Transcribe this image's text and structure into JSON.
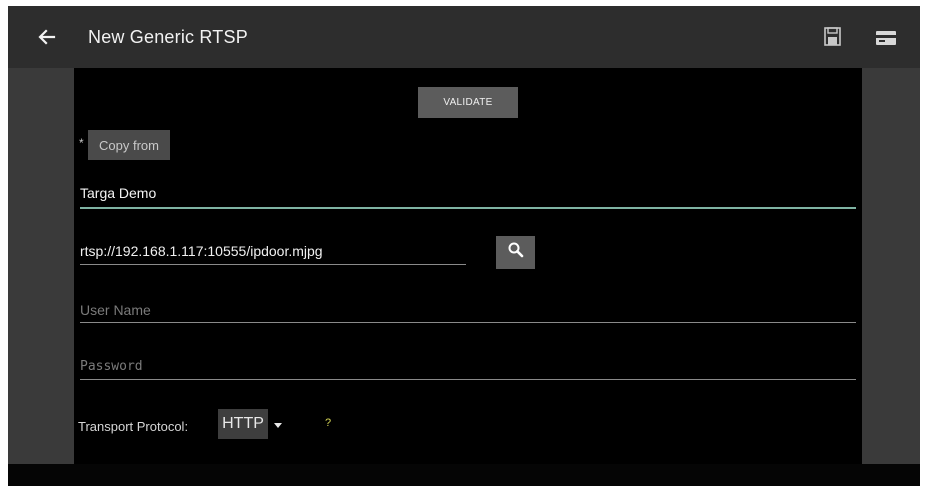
{
  "app": {
    "title": "New Generic RTSP",
    "actions": {
      "back": "back-arrow-icon",
      "save": "save-icon",
      "card": "card-icon"
    }
  },
  "form": {
    "validate_label": "VALIDATE",
    "required_marker": "*",
    "copy_from_label": "Copy from",
    "name_value": "Targa Demo",
    "url_value": "rtsp://192.168.1.117:10555/ipdoor.mjpg",
    "search_icon": "search-icon",
    "username_placeholder": "User Name",
    "password_placeholder": "Password",
    "transport_label": "Transport Protocol:",
    "transport_value": "HTTP",
    "help_label": "?"
  },
  "colors": {
    "appbar": "#2d2d2d",
    "panel": "#000000",
    "sides": "#3a3a3a",
    "button": "#5c5c5c",
    "focus_underline": "#7fb3a3",
    "help": "#d6d655"
  }
}
